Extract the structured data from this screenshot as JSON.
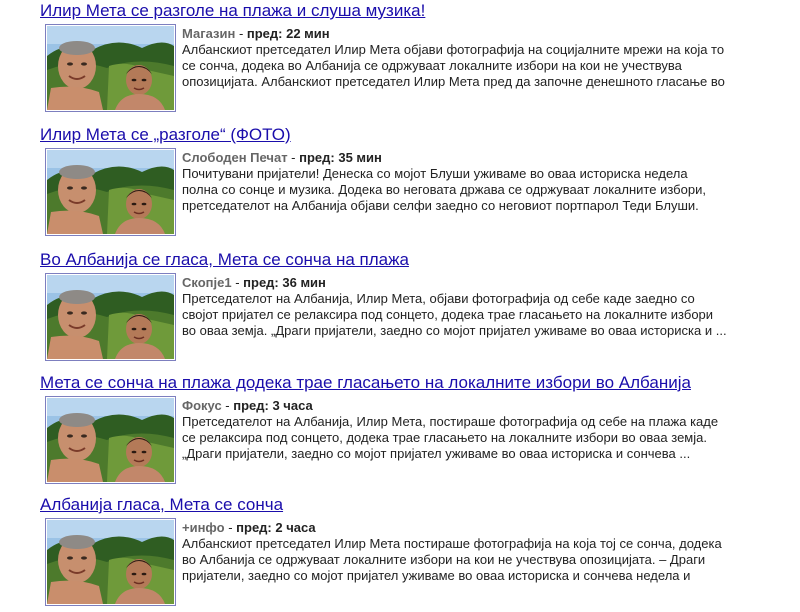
{
  "items": [
    {
      "headline": "Илир Мета се разголе на плажа и слуша музика!",
      "source": "Магазин",
      "time": "пред: 22 мин",
      "snippet": [
        "Албанскиот претседател Илир Мета објави фотографија на социјалните мрежи на која то",
        "се сонча, додека во Албанија се одржуваат локалните избори на кои не учествува",
        "опозицијата. Албанскиот претседател Илир Мета пред да започне денешното гласање во"
      ]
    },
    {
      "headline": "Илир Мета се „разголе“ (ФОТО)",
      "source": "Слободен Печат",
      "time": "пред: 35 мин",
      "snippet": [
        "Почитувани пријатели! Денеска со мојот Блуши уживаме во оваа историска недела",
        "полна со сонце и музика. Додека во неговата држава се одржуваат локалните избори,",
        "претседателот на Албанија објави селфи заедно со неговиот портпарол Теди Блуши."
      ]
    },
    {
      "headline": "Во Албанија се гласа, Мета се сонча на плажа",
      "source": "Скопје1",
      "time": "пред: 36 мин",
      "snippet": [
        "Претседателот на Албанија, Илир Мета, објави фотографија од себе каде заедно со",
        "својот пријател се релаксира под сонцето, додека трае гласањето на локалните избори",
        "во оваа земја. „Драги пријатели, заедно со мојот пријател уживаме во оваа историска и ..."
      ]
    },
    {
      "headline": "Мета се сонча на плажа додека трае гласањето на локалните избори во Албанија",
      "source": "Фокус",
      "time": "пред: 3 часа",
      "snippet": [
        "Претседателот на Албанија, Илир Мета, постираше фотографија од себе на плажа каде",
        "се релаксира под сонцето, додека трае гласањето на локалните избори во оваа земја.",
        "„Драги пријатели, заедно со мојот пријател уживаме во оваа историска и сончева ..."
      ]
    },
    {
      "headline": "Албанија гласа, Мета се сонча",
      "source": "+инфо",
      "time": "пред: 2 часа",
      "snippet": [
        "Албанскиот претседател Илир Мета постираше фотографија на која тој се сонча, додека",
        "во Албанија се одржуваат локалните избори на кои не учествува опозицијата. – Драги",
        "пријатели, заедно со мојот пријател уживаме во оваа историска и сончева недела и"
      ]
    }
  ],
  "separator": " - "
}
